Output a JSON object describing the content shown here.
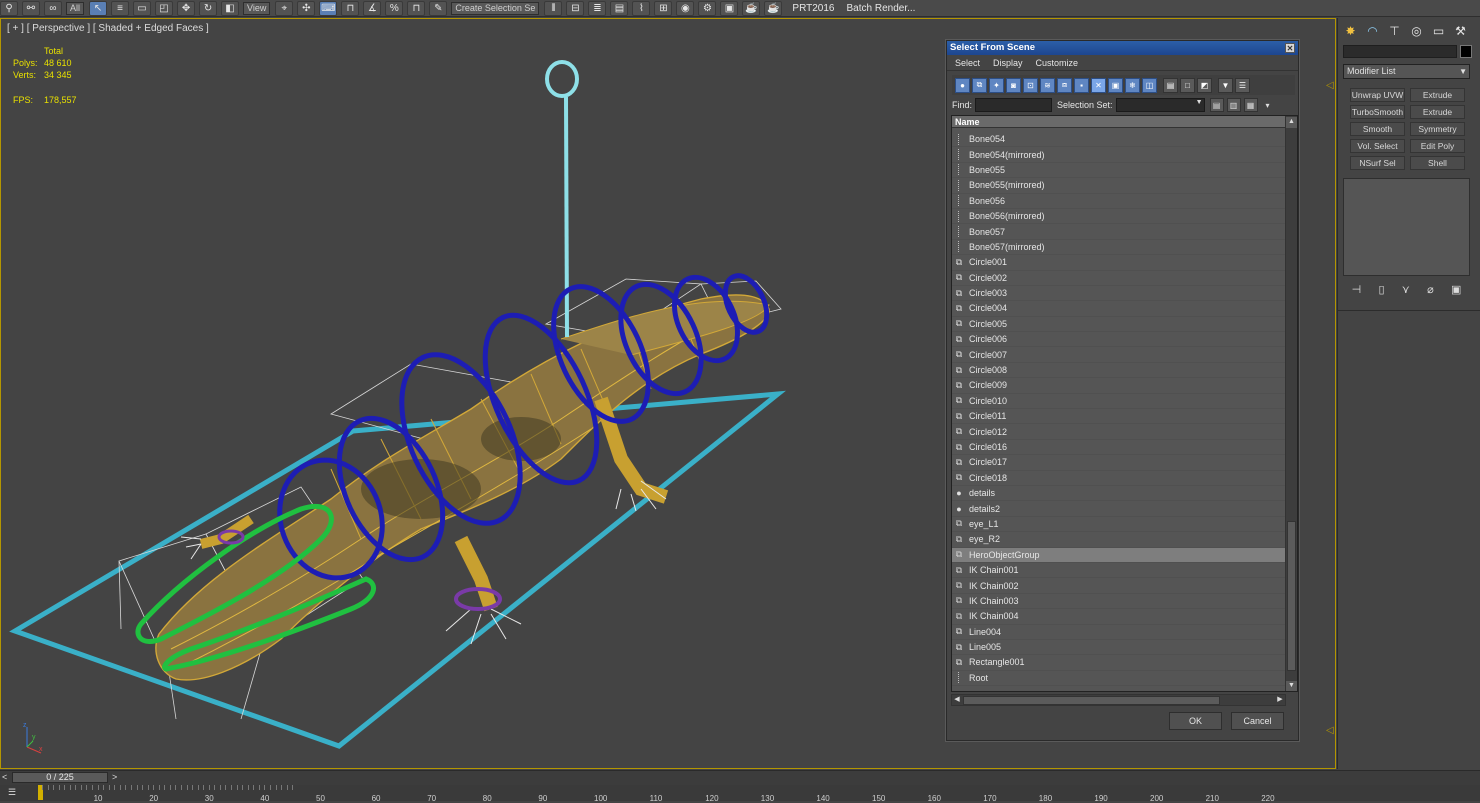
{
  "toolbar": {
    "dropdown_all": "All",
    "dropdown_view": "View",
    "selection_set_placeholder": "Create Selection Se",
    "prt_label": "PRT2016",
    "batch_render": "Batch Render..."
  },
  "viewport": {
    "label": "[ + ] [ Perspective ] [ Shaded + Edged Faces ]",
    "stats": {
      "total_label": "Total",
      "polys_label": "Polys:",
      "polys_value": "48 610",
      "verts_label": "Verts:",
      "verts_value": "34 345",
      "fps_label": "FPS:",
      "fps_value": "178,557"
    },
    "gizmo_x": "x",
    "gizmo_y": "y",
    "gizmo_z": "z"
  },
  "command_panel": {
    "modifier_list": "Modifier List",
    "modifier_buttons": [
      "Unwrap UVW",
      "Extrude",
      "TurboSmooth",
      "Extrude",
      "Smooth",
      "Symmetry",
      "Vol. Select",
      "Edit Poly",
      "NSurf Sel",
      "Shell"
    ]
  },
  "timebar": {
    "frame_counter": "0 / 225",
    "left_arrow": "<",
    "right_arrow": ">",
    "tick_labels": [
      "10",
      "20",
      "30",
      "40",
      "50",
      "60",
      "70",
      "80",
      "90",
      "100",
      "110",
      "120",
      "130",
      "140",
      "150",
      "160",
      "170",
      "180",
      "190",
      "200",
      "210",
      "220"
    ]
  },
  "dialog": {
    "title": "Select From Scene",
    "menu": [
      "Select",
      "Display",
      "Customize"
    ],
    "find_label": "Find:",
    "selection_set_label": "Selection Set:",
    "column_name": "Name",
    "ok": "OK",
    "cancel": "Cancel",
    "rows": [
      {
        "name": "Bone054",
        "type": "bone"
      },
      {
        "name": "Bone054(mirrored)",
        "type": "bone"
      },
      {
        "name": "Bone055",
        "type": "bone"
      },
      {
        "name": "Bone055(mirrored)",
        "type": "bone"
      },
      {
        "name": "Bone056",
        "type": "bone"
      },
      {
        "name": "Bone056(mirrored)",
        "type": "bone"
      },
      {
        "name": "Bone057",
        "type": "bone"
      },
      {
        "name": "Bone057(mirrored)",
        "type": "bone"
      },
      {
        "name": "Circle001",
        "type": "shape"
      },
      {
        "name": "Circle002",
        "type": "shape"
      },
      {
        "name": "Circle003",
        "type": "shape"
      },
      {
        "name": "Circle004",
        "type": "shape"
      },
      {
        "name": "Circle005",
        "type": "shape"
      },
      {
        "name": "Circle006",
        "type": "shape"
      },
      {
        "name": "Circle007",
        "type": "shape"
      },
      {
        "name": "Circle008",
        "type": "shape"
      },
      {
        "name": "Circle009",
        "type": "shape"
      },
      {
        "name": "Circle010",
        "type": "shape"
      },
      {
        "name": "Circle011",
        "type": "shape"
      },
      {
        "name": "Circle012",
        "type": "shape"
      },
      {
        "name": "Circle016",
        "type": "shape"
      },
      {
        "name": "Circle017",
        "type": "shape"
      },
      {
        "name": "Circle018",
        "type": "shape"
      },
      {
        "name": "details",
        "type": "geo"
      },
      {
        "name": "details2",
        "type": "geo"
      },
      {
        "name": "eye_L1",
        "type": "ik"
      },
      {
        "name": "eye_R2",
        "type": "ik"
      },
      {
        "name": "HeroObjectGroup",
        "type": "ik",
        "selected": true
      },
      {
        "name": "IK Chain001",
        "type": "ik"
      },
      {
        "name": "IK Chain002",
        "type": "ik"
      },
      {
        "name": "IK Chain003",
        "type": "ik"
      },
      {
        "name": "IK Chain004",
        "type": "ik"
      },
      {
        "name": "Line004",
        "type": "shape"
      },
      {
        "name": "Line005",
        "type": "shape"
      },
      {
        "name": "Rectangle001",
        "type": "shape"
      },
      {
        "name": "Root",
        "type": "bone"
      }
    ]
  },
  "colors": {
    "viewport_bg": "#444444",
    "stats_text": "#e8e000",
    "title_bar": "#2c5fa8",
    "selected_row": "#7e7e7e",
    "wire_cyan": "#3ab0c8",
    "ring_blue": "#1d1db4",
    "ring_green": "#20c040",
    "mesh_gold": "#c8a030"
  }
}
